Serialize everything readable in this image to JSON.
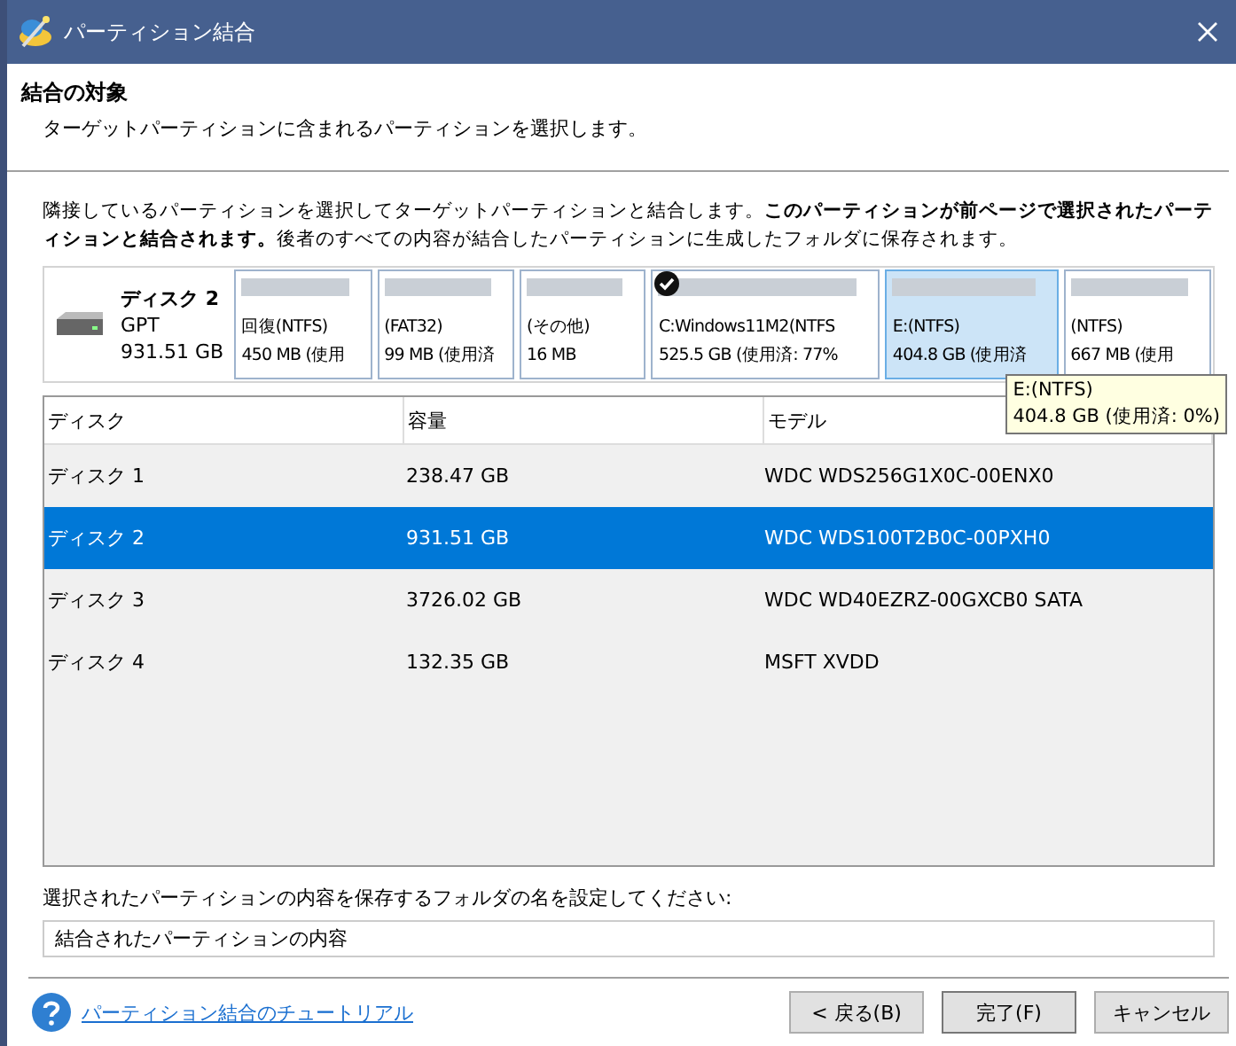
{
  "window": {
    "title": "パーティション結合"
  },
  "header": {
    "title": "結合の対象",
    "subtitle": "ターゲットパーティションに含まれるパーティションを選択します。"
  },
  "description": "隣接しているパーティションを選択してターゲットパーティションと結合します。**このパーティションが前ページで選択されたパーティションと結合されます。**後者のすべての内容が結合したパーティションに生成したフォルダに保存されます。",
  "disk": {
    "name": "ディスク 2",
    "style": "GPT",
    "size": "931.51 GB"
  },
  "partitions": [
    {
      "label": "回復(NTFS)",
      "detail": "450 MB (使用",
      "checked": false,
      "selected": false
    },
    {
      "label": "(FAT32)",
      "detail": "99 MB (使用済",
      "checked": false,
      "selected": false
    },
    {
      "label": "(その他)",
      "detail": "16 MB",
      "checked": false,
      "selected": false
    },
    {
      "label": "C:Windows11M2(NTFS",
      "detail": "525.5 GB (使用済: 77%",
      "checked": true,
      "selected": false
    },
    {
      "label": "E:(NTFS)",
      "detail": "404.8 GB (使用済",
      "checked": false,
      "selected": true
    },
    {
      "label": "(NTFS)",
      "detail": "667 MB (使用",
      "checked": false,
      "selected": false
    }
  ],
  "tooltip": {
    "title": "E:(NTFS)",
    "detail": "404.8 GB (使用済: 0%)"
  },
  "table": {
    "columns": [
      "ディスク",
      "容量",
      "モデル"
    ],
    "rows": [
      {
        "cells": [
          "ディスク 1",
          "238.47 GB",
          "WDC WDS256G1X0C-00ENX0"
        ],
        "selected": false
      },
      {
        "cells": [
          "ディスク 2",
          "931.51 GB",
          "WDC WDS100T2B0C-00PXH0"
        ],
        "selected": true
      },
      {
        "cells": [
          "ディスク 3",
          "3726.02 GB",
          "WDC WD40EZRZ-00GXCB0 SATA"
        ],
        "selected": false
      },
      {
        "cells": [
          "ディスク 4",
          "132.35 GB",
          "MSFT XVDD"
        ],
        "selected": false
      }
    ]
  },
  "folder": {
    "label": "選択されたパーティションの内容を保存するフォルダの名を設定してください:",
    "value": "結合されたパーティションの内容"
  },
  "footer": {
    "help_link": "パーティション結合のチュートリアル",
    "buttons": [
      "< 戻る(B)",
      "完了(F)",
      "キャンセル"
    ]
  }
}
